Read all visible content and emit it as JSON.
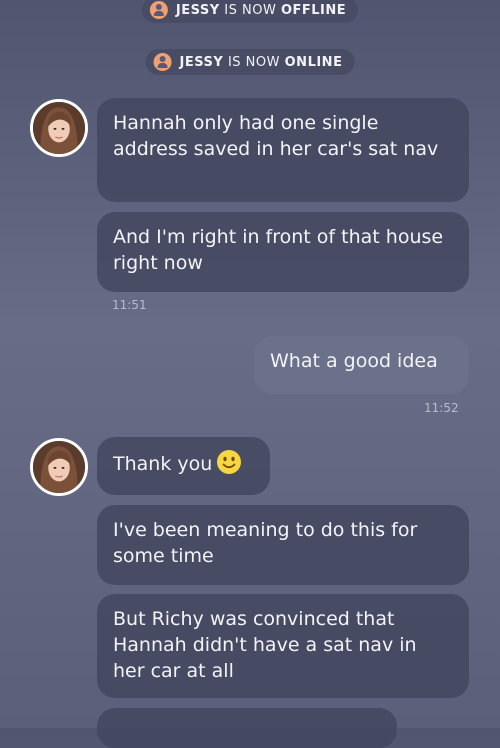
{
  "system_messages": [
    {
      "name": "JESSY",
      "text": " IS NOW ",
      "state": "OFFLINE"
    },
    {
      "name": "JESSY",
      "text": " IS NOW ",
      "state": "ONLINE"
    }
  ],
  "messages": [
    {
      "direction": "in",
      "text": "Hannah only had one single address saved in her car's sat nav"
    },
    {
      "direction": "in",
      "text": "And I'm right in front of that house right now",
      "time": "11:51"
    },
    {
      "direction": "out",
      "text": "What a good idea",
      "time": "11:52"
    },
    {
      "direction": "in",
      "text": "Thank you",
      "emoji": "slightly-smiling-face-icon"
    },
    {
      "direction": "in",
      "text": "I've been meaning to do this for some time"
    },
    {
      "direction": "in",
      "text": "But Richy was convinced that Hannah didn't have a sat nav in her car at all"
    }
  ],
  "colors": {
    "background_top": "#505570",
    "incoming_bubble": "#42465e",
    "outgoing_bubble": "#6c718c",
    "status_icon": "#f0a070",
    "emoji": "#f7d640"
  }
}
